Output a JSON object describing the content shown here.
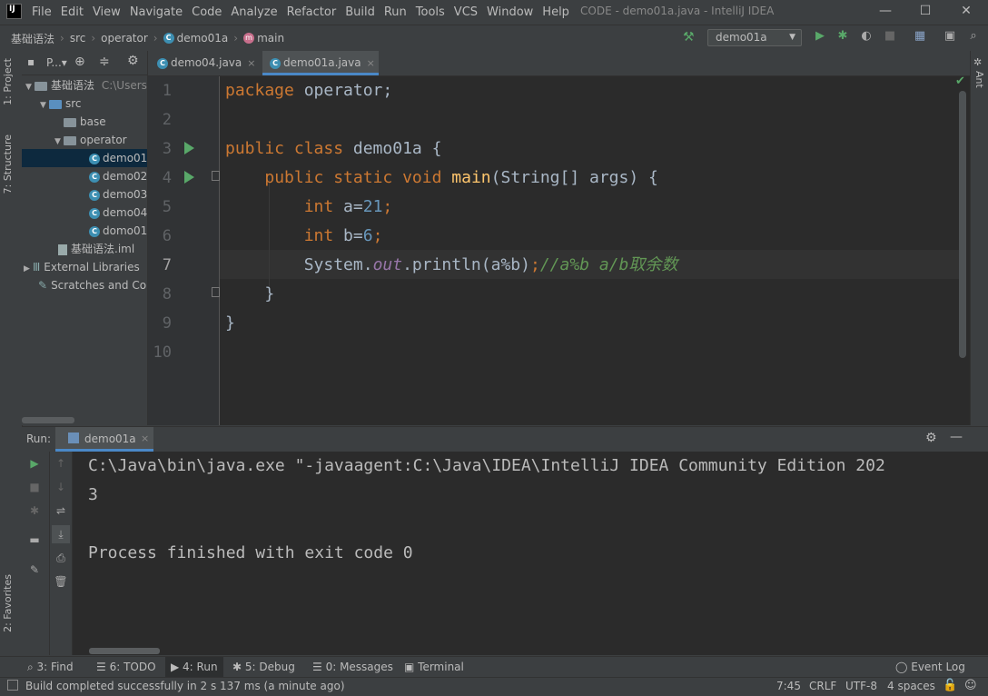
{
  "menu": [
    "File",
    "Edit",
    "View",
    "Navigate",
    "Code",
    "Analyze",
    "Refactor",
    "Build",
    "Run",
    "Tools",
    "VCS",
    "Window",
    "Help"
  ],
  "window_title": "CODE - demo01a.java - IntelliJ IDEA",
  "breadcrumb": [
    "基础语法",
    "src",
    "operator",
    "demo01a",
    "main"
  ],
  "run_config": "demo01a",
  "left_tabs": {
    "project": "1: Project",
    "structure": "7: Structure",
    "favorites": "2: Favorites"
  },
  "right_tabs": {
    "ant": "Ant"
  },
  "project_panel": {
    "title": "P...▾",
    "root_name": "基础语法",
    "root_path": "C:\\Users",
    "items": [
      {
        "label": "src"
      },
      {
        "label": "base"
      },
      {
        "label": "operator"
      },
      {
        "label": "demo01"
      },
      {
        "label": "demo02"
      },
      {
        "label": "demo03"
      },
      {
        "label": "demo04"
      },
      {
        "label": "domo01"
      },
      {
        "label": "基础语法.iml"
      },
      {
        "label": "External Libraries"
      },
      {
        "label": "Scratches and Co"
      }
    ]
  },
  "editor_tabs": [
    {
      "label": "demo04.java"
    },
    {
      "label": "demo01a.java"
    }
  ],
  "line_numbers": [
    "1",
    "2",
    "3",
    "4",
    "5",
    "6",
    "7",
    "8",
    "9",
    "10"
  ],
  "code": {
    "l1_kw": "package",
    "l1_rest": " operator;",
    "l3_kw": "public class",
    "l3_rest": " demo01a {",
    "l4_kw": "public static void",
    "l4_fn": "main",
    "l4_rest": "(String[] args) {",
    "l5_kw": "int",
    "l5_a": " a=",
    "l5_num": "21",
    "l5_end": ";",
    "l6_kw": "int",
    "l6_a": " b=",
    "l6_num": "6",
    "l6_end": ";",
    "l7_a": "System.",
    "l7_field": "out",
    "l7_b": ".println(a%b)",
    "l7_semi": ";",
    "l7_cmt": "//a%b a/b取余数",
    "l8": "}",
    "l9": "}"
  },
  "run_panel": {
    "label": "Run:",
    "tab": "demo01a",
    "console": [
      "C:\\Java\\bin\\java.exe \"-javaagent:C:\\Java\\IDEA\\IntelliJ IDEA Community Edition 202",
      "3",
      "",
      "Process finished with exit code 0"
    ]
  },
  "bottom_tools": [
    {
      "label": "3: Find"
    },
    {
      "label": "6: TODO"
    },
    {
      "label": "4: Run"
    },
    {
      "label": "5: Debug"
    },
    {
      "label": "0: Messages"
    },
    {
      "label": "Terminal"
    }
  ],
  "event_log": "Event Log",
  "status": {
    "message": "Build completed successfully in 2 s 137 ms (a minute ago)",
    "position": "7:45",
    "line_sep": "CRLF",
    "encoding": "UTF-8",
    "indent": "4 spaces"
  }
}
